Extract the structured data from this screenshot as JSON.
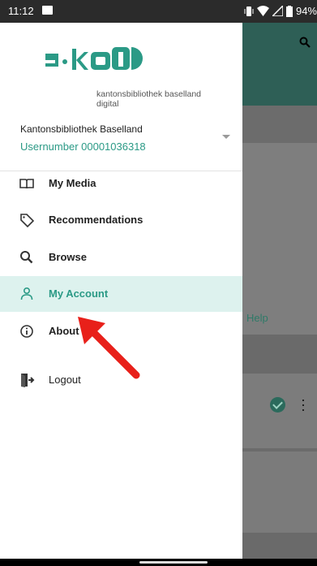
{
  "statusbar": {
    "time": "11:12",
    "battery": "94%"
  },
  "background": {
    "help_label": "Help"
  },
  "drawer": {
    "logo_text": "e·kbl",
    "logo_line1": "kantonsbibliothek baselland",
    "logo_line2": "digital",
    "account_name": "Kantonsbibliothek Baselland",
    "account_number": "Usernumber 00001036318",
    "items": [
      {
        "label": "My Media",
        "icon": "book-icon"
      },
      {
        "label": "Recommendations",
        "icon": "tag-icon"
      },
      {
        "label": "Browse",
        "icon": "search-icon"
      },
      {
        "label": "My Account",
        "icon": "person-icon",
        "active": true
      },
      {
        "label": "About",
        "icon": "info-icon"
      },
      {
        "label": "Logout",
        "icon": "logout-icon"
      }
    ]
  },
  "colors": {
    "accent": "#2b9a86",
    "active_bg": "#ddf2ee",
    "arrow": "#e8201a"
  }
}
